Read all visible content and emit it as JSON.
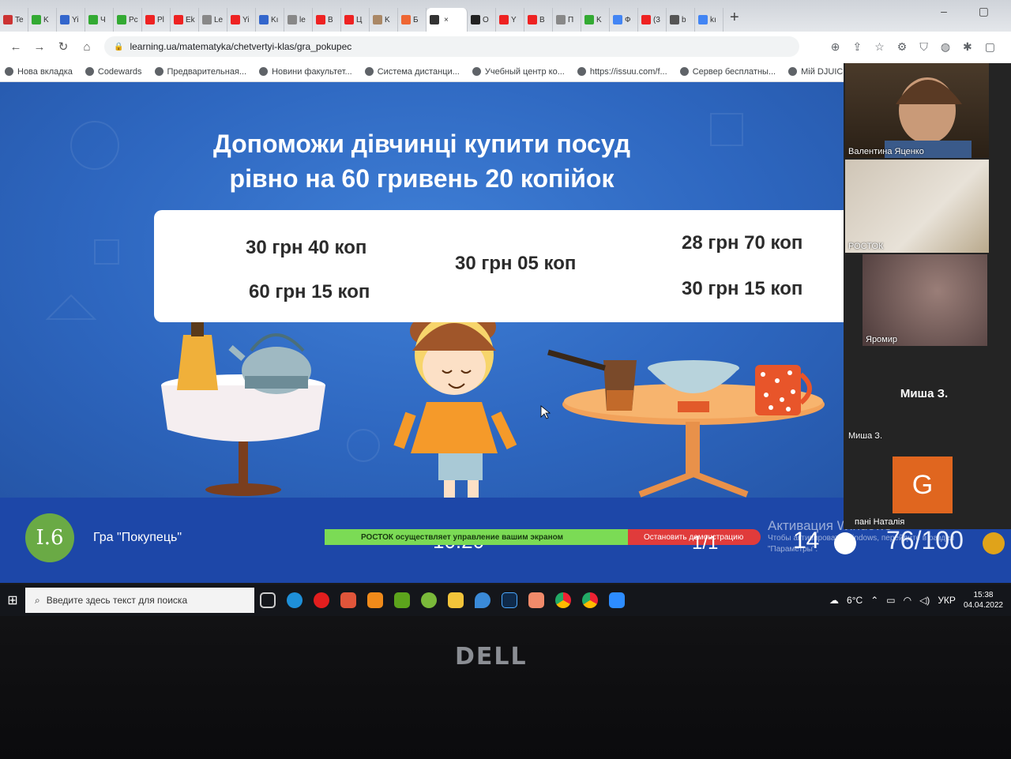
{
  "browser": {
    "tabs": [
      {
        "label": "Te",
        "color": "#c33"
      },
      {
        "label": "K",
        "color": "#3a3"
      },
      {
        "label": "Yi",
        "color": "#36c"
      },
      {
        "label": "Ч",
        "color": "#3a3"
      },
      {
        "label": "Pc",
        "color": "#3a3"
      },
      {
        "label": "Pl",
        "color": "#e22"
      },
      {
        "label": "Ek",
        "color": "#e22"
      },
      {
        "label": "Le",
        "color": "#888"
      },
      {
        "label": "Yi",
        "color": "#e22"
      },
      {
        "label": "Kı",
        "color": "#36c"
      },
      {
        "label": "le",
        "color": "#888"
      },
      {
        "label": "B",
        "color": "#e22"
      },
      {
        "label": "Ц",
        "color": "#e22"
      },
      {
        "label": "K",
        "color": "#a86"
      },
      {
        "label": "Б",
        "color": "#e63"
      },
      {
        "label": "",
        "color": "#333",
        "active": true
      },
      {
        "label": "O",
        "color": "#222"
      },
      {
        "label": "Y",
        "color": "#e22"
      },
      {
        "label": "B",
        "color": "#e22"
      },
      {
        "label": "П",
        "color": "#888"
      },
      {
        "label": "K",
        "color": "#3a3"
      },
      {
        "label": "Ф",
        "color": "#4285f4"
      },
      {
        "label": "(3",
        "color": "#e22"
      },
      {
        "label": "b",
        "color": "#555"
      },
      {
        "label": "kı",
        "color": "#4285f4"
      }
    ],
    "new_tab": "+",
    "window_controls": "– ▢",
    "address": "learning.ua/matematyka/chetvertyi-klas/gra_pokupec",
    "bookmarks": [
      "Нова вкладка",
      "Codewards",
      "Предварительная...",
      "Новини факультет...",
      "Система дистанци...",
      "Учебный центр ко...",
      "https://issuu.com/f...",
      "Сервер бесплатны...",
      "Мій DJUICE - Вхід в..."
    ]
  },
  "game": {
    "title_line1": "Допоможи дівчинці купити посуд",
    "title_line2": "рівно на 60 гривень 20 копійок",
    "prices": {
      "kettle": "30 грн 40 коп",
      "cezve": "60 грн 15 коп",
      "grater": "30 грн 05 коп",
      "colander": "28 грн 70 коп",
      "mug": "30 грн 15 коп"
    },
    "level": "I.6",
    "game_name": "Гра \"Покупець\"",
    "timer": "10:20",
    "progress": "1/1",
    "counter": "14",
    "score": "76/100"
  },
  "zoom": {
    "control_notice": "РОСТОК осуществляет управление вашим экраном",
    "stop_demo": "Остановить демонстрацию",
    "participants": [
      "Валентина Яценко",
      "РОСТОК",
      "Яромир",
      "Миша З.",
      "Миша З.",
      "пані Наталія"
    ],
    "avatar_letter": "G"
  },
  "windows": {
    "activation_title": "Активация Windows",
    "activation_sub": "Чтобы активировать Windows, перейдите в раздел",
    "activation_sub2": "\"Параметры\".",
    "search_placeholder": "Введите здесь текст для поиска",
    "weather": "6°C",
    "language": "УКР",
    "time": "15:38",
    "date": "04.04.2022"
  },
  "laptop_brand": "DELL"
}
